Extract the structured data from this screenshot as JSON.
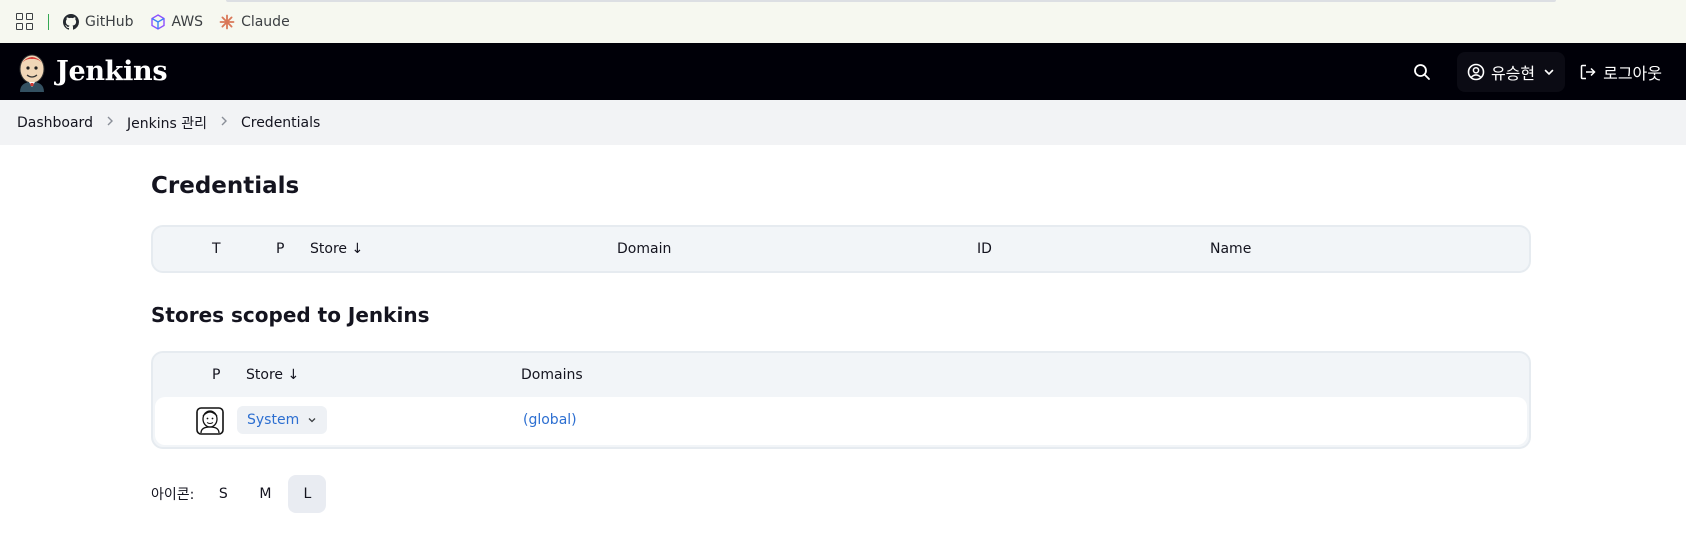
{
  "bookmarks": [
    {
      "label": "GitHub",
      "icon": "github-icon"
    },
    {
      "label": "AWS",
      "icon": "aws-icon"
    },
    {
      "label": "Claude",
      "icon": "claude-icon"
    }
  ],
  "header": {
    "brand": "Jenkins",
    "user": "유승현",
    "logout": "로그아웃"
  },
  "breadcrumb": [
    "Dashboard",
    "Jenkins 관리",
    "Credentials"
  ],
  "main": {
    "title": "Credentials",
    "credentials_table": {
      "headers": {
        "t": "T",
        "p": "P",
        "store": "Store ↓",
        "domain": "Domain",
        "id": "ID",
        "name": "Name"
      }
    },
    "stores_title": "Stores scoped to Jenkins",
    "stores_table": {
      "headers": {
        "p": "P",
        "store": "Store ↓",
        "domains": "Domains"
      },
      "rows": [
        {
          "store": "System",
          "domain": "(global)"
        }
      ]
    },
    "icon_size": {
      "label": "아이콘:",
      "options": [
        "S",
        "M",
        "L"
      ],
      "selected": "L"
    }
  },
  "colors": {
    "link": "#2d6fd1",
    "header_bg": "#000008",
    "breadcrumb_bg": "#f2f3f5"
  }
}
